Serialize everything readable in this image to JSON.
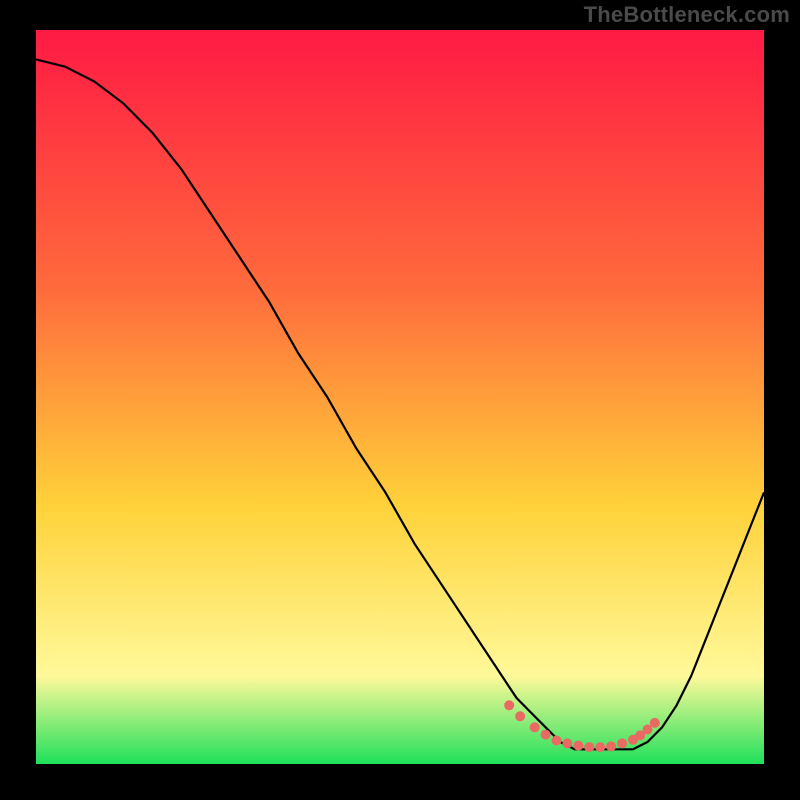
{
  "watermark": "TheBottleneck.com",
  "colors": {
    "gradient_top": "#ff1a44",
    "gradient_mid1": "#ff6a3c",
    "gradient_mid2": "#ffd23a",
    "gradient_bottom_yellow": "#fff99a",
    "gradient_bottom_green": "#1fe05a",
    "curve": "#000000",
    "dots": "#e96a63"
  },
  "chart_data": {
    "type": "line",
    "title": "",
    "xlabel": "",
    "ylabel": "",
    "xlim": [
      0,
      100
    ],
    "ylim": [
      0,
      100
    ],
    "series": [
      {
        "name": "bottleneck-curve",
        "x": [
          0,
          4,
          8,
          12,
          16,
          20,
          24,
          28,
          32,
          36,
          40,
          44,
          48,
          52,
          56,
          60,
          64,
          66,
          68,
          70,
          72,
          74,
          76,
          78,
          80,
          82,
          84,
          86,
          88,
          90,
          92,
          94,
          96,
          98,
          100
        ],
        "values": [
          96,
          95,
          93,
          90,
          86,
          81,
          75,
          69,
          63,
          56,
          50,
          43,
          37,
          30,
          24,
          18,
          12,
          9,
          7,
          5,
          3,
          2,
          2,
          2,
          2,
          2,
          3,
          5,
          8,
          12,
          17,
          22,
          27,
          32,
          37
        ]
      }
    ],
    "highlight_points": {
      "name": "optimal-range-dots",
      "x": [
        65,
        66.5,
        68.5,
        70,
        71.5,
        73,
        74.5,
        76,
        77.5,
        79,
        80.5,
        82,
        83,
        84,
        85
      ],
      "values": [
        8,
        6.5,
        5,
        4,
        3.2,
        2.8,
        2.5,
        2.3,
        2.3,
        2.4,
        2.8,
        3.3,
        3.9,
        4.7,
        5.6
      ]
    }
  }
}
